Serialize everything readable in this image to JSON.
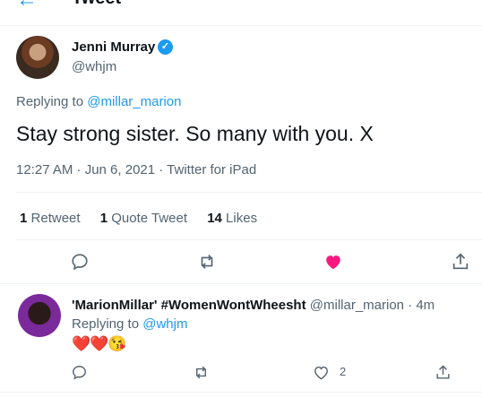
{
  "header": {
    "title": "Tweet",
    "back_icon": "back-arrow-icon"
  },
  "tweet": {
    "author_name": "Jenni Murray",
    "author_handle": "@whjm",
    "verified_icon": "verified-badge-icon",
    "replying_prefix": "Replying to",
    "replying_to": "@millar_marion",
    "text": "Stay strong sister. So many with you. X",
    "timestamp": "12:27 AM · Jun 6, 2021 · Twitter for iPad",
    "stats": {
      "retweets_count": "1",
      "retweets_label": "Retweet",
      "quotes_count": "1",
      "quotes_label": "Quote Tweet",
      "likes_count": "14",
      "likes_label": "Likes"
    },
    "liked": true
  },
  "reply": {
    "author_name": "'MarionMillar' #WomenWontWheesht",
    "author_handle": "@millar_marion · 4m",
    "replying_prefix": "Replying to",
    "replying_to": "@whjm",
    "text": "❤️❤️😘",
    "like_count": "2"
  },
  "colors": {
    "accent": "#1d9bf0",
    "like": "#f91880",
    "muted": "#536471"
  }
}
